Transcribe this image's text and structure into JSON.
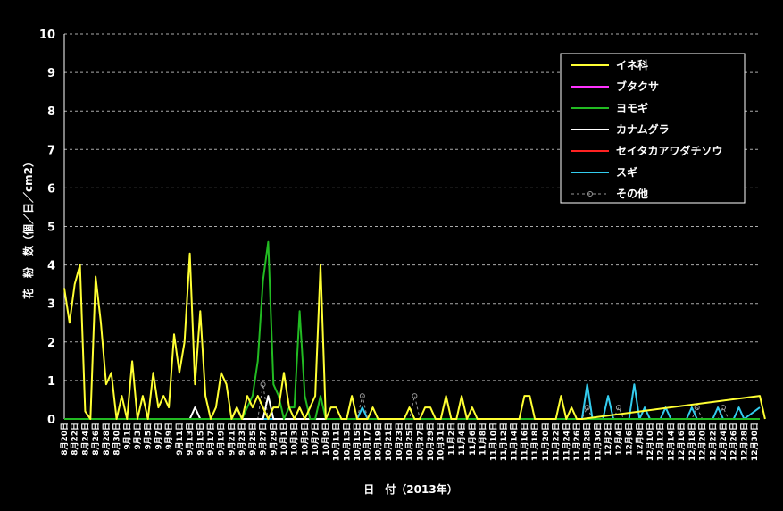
{
  "chart_data": {
    "type": "line",
    "title": "",
    "xlabel": "日　付（2013年）",
    "ylabel": "花　粉　数（個／日／cm2）",
    "ylim": [
      0,
      10
    ],
    "yticks": [
      "0",
      "1",
      "2",
      "3",
      "4",
      "5",
      "6",
      "7",
      "8",
      "9",
      "10"
    ],
    "grid": true,
    "legend_position": "top-right",
    "x_labels": [
      "8月20日",
      "8月22日",
      "8月24日",
      "8月26日",
      "8月28日",
      "8月30日",
      "9月1日",
      "9月3日",
      "9月5日",
      "9月7日",
      "9月9日",
      "9月11日",
      "9月13日",
      "9月15日",
      "9月17日",
      "9月19日",
      "9月21日",
      "9月23日",
      "9月25日",
      "9月27日",
      "9月29日",
      "10月1日",
      "10月3日",
      "10月5日",
      "10月7日",
      "10月9日",
      "10月11日",
      "10月13日",
      "10月15日",
      "10月17日",
      "10月19日",
      "10月21日",
      "10月23日",
      "10月25日",
      "10月27日",
      "10月29日",
      "10月31日",
      "11月2日",
      "11月4日",
      "11月6日",
      "11月8日",
      "11月10日",
      "11月12日",
      "11月14日",
      "11月16日",
      "11月18日",
      "11月20日",
      "11月22日",
      "11月24日",
      "11月26日",
      "11月28日",
      "11月30日",
      "12月2日",
      "12月4日",
      "12月6日",
      "12月8日",
      "12月10日",
      "12月12日",
      "12月14日",
      "12月16日",
      "12月18日",
      "12月20日",
      "12月22日",
      "12月24日",
      "12月26日",
      "12月28日",
      "12月30日"
    ],
    "days": 134,
    "series": [
      {
        "name": "イネ科",
        "color": "#ffff33",
        "dash": "none",
        "points": [
          [
            0,
            3.4
          ],
          [
            1,
            2.5
          ],
          [
            2,
            3.5
          ],
          [
            3,
            4.0
          ],
          [
            4,
            0.2
          ],
          [
            5,
            0
          ],
          [
            6,
            3.7
          ],
          [
            7,
            2.5
          ],
          [
            8,
            0.9
          ],
          [
            9,
            1.2
          ],
          [
            10,
            0
          ],
          [
            11,
            0.6
          ],
          [
            12,
            0
          ],
          [
            13,
            1.5
          ],
          [
            14,
            0
          ],
          [
            15,
            0.6
          ],
          [
            16,
            0
          ],
          [
            17,
            1.2
          ],
          [
            18,
            0.3
          ],
          [
            19,
            0.6
          ],
          [
            20,
            0.3
          ],
          [
            21,
            2.2
          ],
          [
            22,
            1.2
          ],
          [
            23,
            2.0
          ],
          [
            24,
            4.3
          ],
          [
            25,
            0.9
          ],
          [
            26,
            2.8
          ],
          [
            27,
            0.6
          ],
          [
            28,
            0
          ],
          [
            29,
            0.3
          ],
          [
            30,
            1.2
          ],
          [
            31,
            0.9
          ],
          [
            32,
            0
          ],
          [
            33,
            0.3
          ],
          [
            34,
            0
          ],
          [
            35,
            0.6
          ],
          [
            36,
            0.3
          ],
          [
            37,
            0.6
          ],
          [
            38,
            0.3
          ],
          [
            39,
            0
          ],
          [
            40,
            0.3
          ],
          [
            41,
            0.3
          ],
          [
            42,
            1.2
          ],
          [
            43,
            0.3
          ],
          [
            44,
            0
          ],
          [
            45,
            0.3
          ],
          [
            46,
            0
          ],
          [
            47,
            0.3
          ],
          [
            48,
            0.6
          ],
          [
            49,
            4.0
          ],
          [
            50,
            0
          ],
          [
            51,
            0.3
          ],
          [
            52,
            0.3
          ],
          [
            53,
            0
          ],
          [
            54,
            0
          ],
          [
            55,
            0.6
          ],
          [
            56,
            0
          ],
          [
            57,
            0
          ],
          [
            58,
            0
          ],
          [
            59,
            0.3
          ],
          [
            60,
            0
          ],
          [
            61,
            0
          ],
          [
            62,
            0
          ],
          [
            63,
            0
          ],
          [
            64,
            0
          ],
          [
            65,
            0
          ],
          [
            66,
            0.3
          ],
          [
            67,
            0
          ],
          [
            68,
            0
          ],
          [
            69,
            0.3
          ],
          [
            70,
            0.3
          ],
          [
            71,
            0
          ],
          [
            72,
            0
          ],
          [
            73,
            0.6
          ],
          [
            74,
            0
          ],
          [
            75,
            0
          ],
          [
            76,
            0.6
          ],
          [
            77,
            0
          ],
          [
            78,
            0.3
          ],
          [
            79,
            0
          ],
          [
            80,
            0
          ],
          [
            81,
            0
          ],
          [
            82,
            0
          ],
          [
            83,
            0
          ],
          [
            84,
            0
          ],
          [
            85,
            0
          ],
          [
            86,
            0
          ],
          [
            87,
            0
          ],
          [
            88,
            0.6
          ],
          [
            89,
            0.6
          ],
          [
            90,
            0
          ],
          [
            91,
            0
          ],
          [
            92,
            0
          ],
          [
            93,
            0
          ],
          [
            94,
            0
          ],
          [
            95,
            0.6
          ],
          [
            96,
            0
          ],
          [
            97,
            0.3
          ],
          [
            98,
            0
          ],
          [
            99,
            0
          ],
          [
            134,
            0
          ],
          [
            133,
            0.6
          ]
        ]
      },
      {
        "name": "ブタクサ",
        "color": "#ff33ff",
        "dash": "none",
        "points": [
          [
            0,
            0
          ],
          [
            133,
            0
          ]
        ]
      },
      {
        "name": "ヨモギ",
        "color": "#22bb22",
        "dash": "none",
        "points": [
          [
            0,
            0
          ],
          [
            34,
            0
          ],
          [
            35,
            0.3
          ],
          [
            36,
            0.6
          ],
          [
            37,
            1.5
          ],
          [
            38,
            3.6
          ],
          [
            39,
            4.6
          ],
          [
            40,
            0.9
          ],
          [
            41,
            0.6
          ],
          [
            42,
            0
          ],
          [
            43,
            0.3
          ],
          [
            44,
            0.3
          ],
          [
            45,
            2.8
          ],
          [
            46,
            0.6
          ],
          [
            47,
            0
          ],
          [
            48,
            0
          ],
          [
            49,
            0.6
          ],
          [
            50,
            0
          ],
          [
            133,
            0
          ]
        ]
      },
      {
        "name": "カナムグラ",
        "color": "#ffffff",
        "dash": "none",
        "points": [
          [
            0,
            0
          ],
          [
            24,
            0
          ],
          [
            25,
            0.3
          ],
          [
            26,
            0
          ],
          [
            32,
            0
          ],
          [
            33,
            0.3
          ],
          [
            34,
            0
          ],
          [
            38,
            0
          ],
          [
            39,
            0.6
          ],
          [
            40,
            0
          ],
          [
            133,
            0
          ]
        ]
      },
      {
        "name": "セイタカアワダチソウ",
        "color": "#ff2222",
        "dash": "none",
        "points": [
          [
            0,
            0
          ],
          [
            133,
            0
          ]
        ]
      },
      {
        "name": "スギ",
        "color": "#33ccee",
        "dash": "none",
        "points": [
          [
            0,
            0
          ],
          [
            56,
            0
          ],
          [
            57,
            0.3
          ],
          [
            58,
            0
          ],
          [
            99,
            0
          ],
          [
            100,
            0.9
          ],
          [
            101,
            0
          ],
          [
            103,
            0
          ],
          [
            104,
            0.6
          ],
          [
            105,
            0
          ],
          [
            108,
            0
          ],
          [
            109,
            0.9
          ],
          [
            110,
            0
          ],
          [
            111,
            0.3
          ],
          [
            112,
            0
          ],
          [
            114,
            0
          ],
          [
            115,
            0.3
          ],
          [
            116,
            0
          ],
          [
            119,
            0
          ],
          [
            120,
            0.3
          ],
          [
            121,
            0
          ],
          [
            124,
            0
          ],
          [
            125,
            0.3
          ],
          [
            126,
            0
          ],
          [
            128,
            0
          ],
          [
            129,
            0.3
          ],
          [
            130,
            0
          ],
          [
            133,
            0.3
          ]
        ]
      },
      {
        "name": "その他",
        "color": "#999999",
        "dash": "3,3",
        "points": [
          [
            0,
            0
          ],
          [
            37,
            0
          ],
          [
            38,
            0.9
          ],
          [
            39,
            0
          ],
          [
            56,
            0
          ],
          [
            57,
            0.6
          ],
          [
            58,
            0
          ],
          [
            66,
            0
          ],
          [
            67,
            0.6
          ],
          [
            68,
            0
          ],
          [
            99,
            0
          ],
          [
            100,
            0.3
          ],
          [
            101,
            0
          ],
          [
            105,
            0
          ],
          [
            106,
            0.3
          ],
          [
            107,
            0
          ],
          [
            120,
            0
          ],
          [
            121,
            0.3
          ],
          [
            122,
            0
          ],
          [
            125,
            0
          ],
          [
            126,
            0.3
          ],
          [
            127,
            0
          ],
          [
            133,
            0
          ]
        ]
      }
    ]
  }
}
